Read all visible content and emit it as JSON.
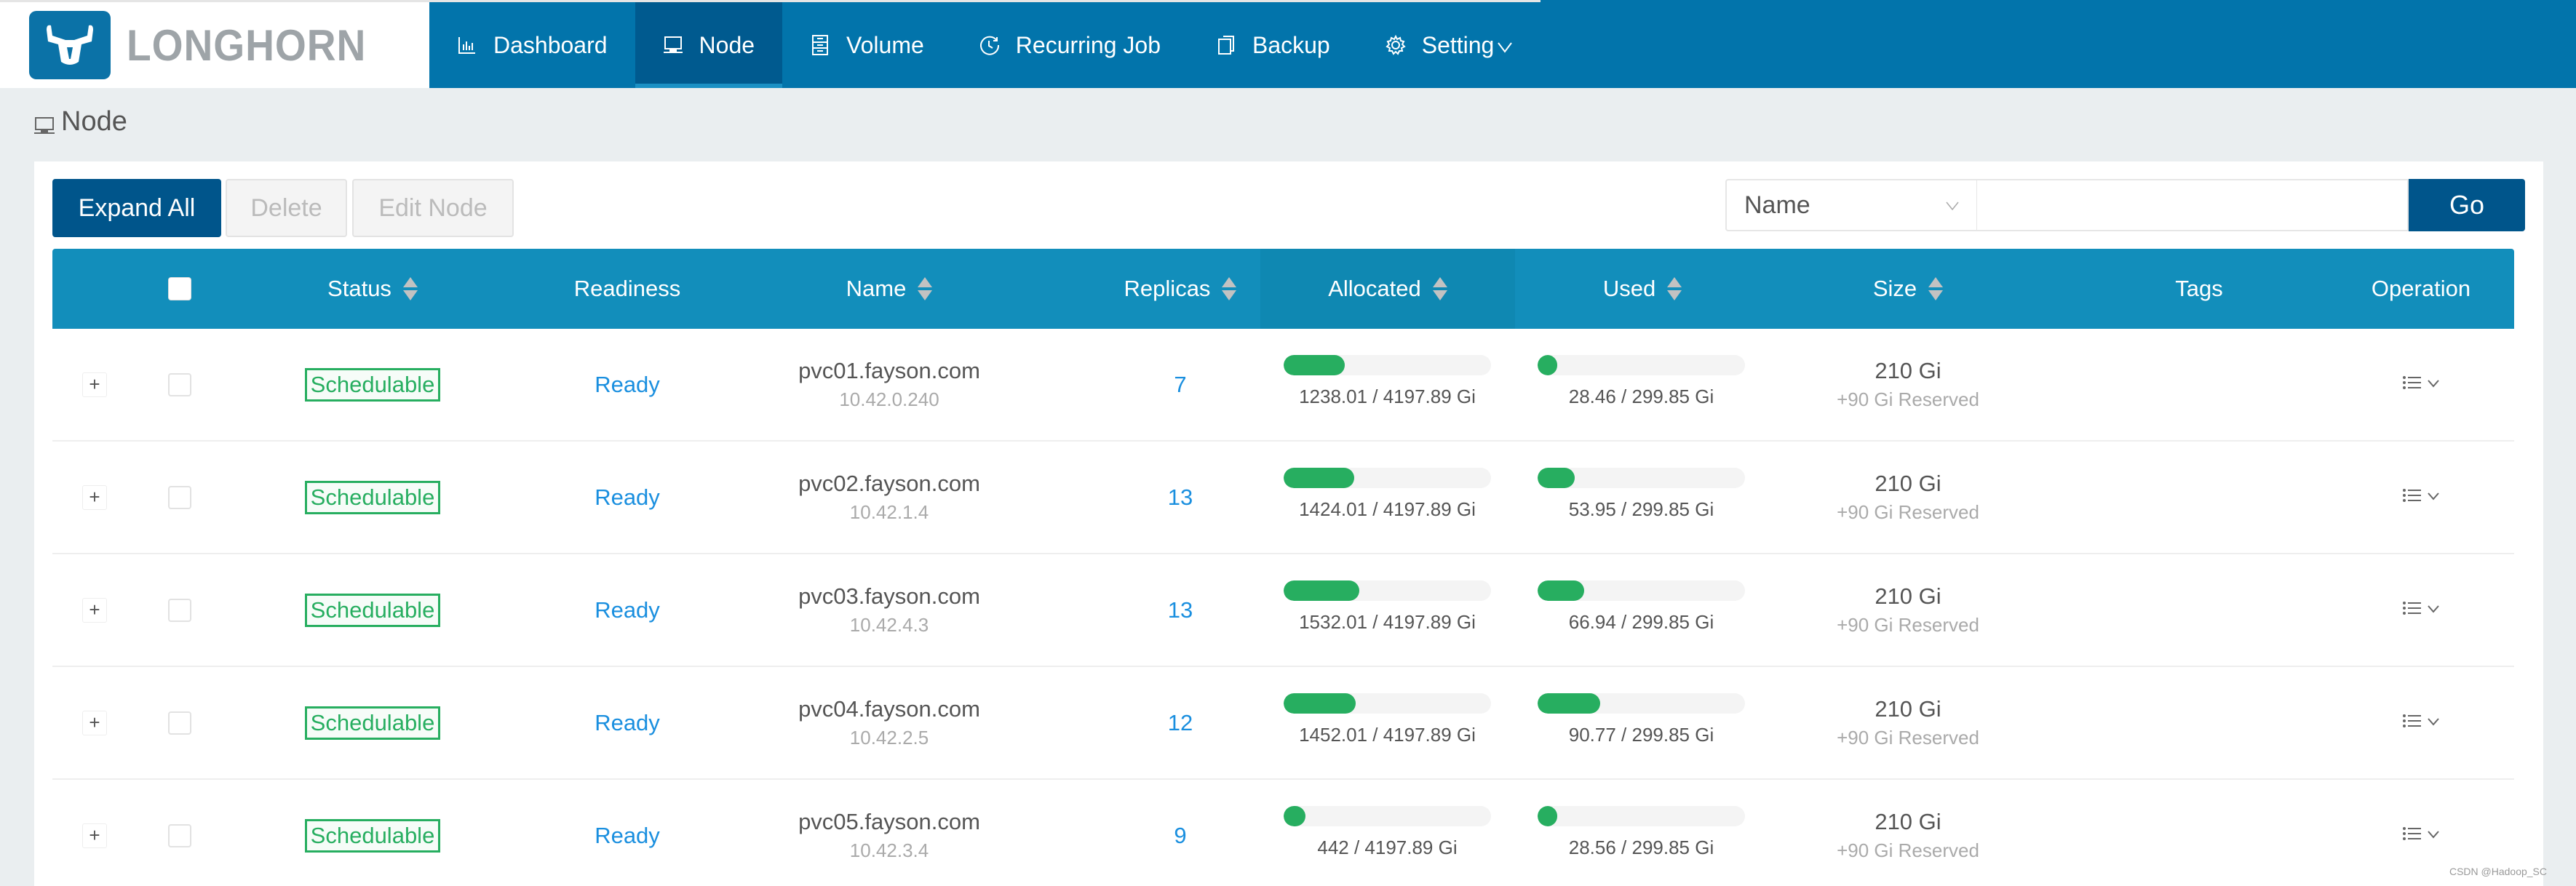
{
  "brand": {
    "name": "LONGHORN",
    "logo_icon": "longhorn-logo-icon"
  },
  "nav": [
    {
      "label": "Dashboard",
      "icon": "bar-chart-icon",
      "active": false
    },
    {
      "label": "Node",
      "icon": "laptop-icon",
      "active": true
    },
    {
      "label": "Volume",
      "icon": "database-icon",
      "active": false
    },
    {
      "label": "Recurring Job",
      "icon": "clock-icon",
      "active": false
    },
    {
      "label": "Backup",
      "icon": "copy-icon",
      "active": false
    },
    {
      "label": "Setting",
      "icon": "gear-icon",
      "active": false,
      "has_dropdown": true
    }
  ],
  "page": {
    "title": "Node",
    "icon": "laptop-icon"
  },
  "toolbar": {
    "expand_all": "Expand All",
    "delete": "Delete",
    "edit_node": "Edit Node"
  },
  "search": {
    "field_selected": "Name",
    "input_value": "",
    "input_placeholder": "",
    "go_label": "Go"
  },
  "table": {
    "headers": {
      "status": "Status",
      "readiness": "Readiness",
      "name": "Name",
      "replicas": "Replicas",
      "allocated": "Allocated",
      "used": "Used",
      "size": "Size",
      "tags": "Tags",
      "operation": "Operation"
    },
    "rows": [
      {
        "status": "Schedulable",
        "readiness": "Ready",
        "name": "pvc01.fayson.com",
        "ip": "10.42.0.240",
        "replicas": "7",
        "allocated_label": "1238.01 / 4197.89 Gi",
        "allocated_fraction": 0.295,
        "used_label": "28.46 / 299.85 Gi",
        "used_fraction": 0.095,
        "size": "210 Gi",
        "reserved": "+90 Gi Reserved",
        "tags": ""
      },
      {
        "status": "Schedulable",
        "readiness": "Ready",
        "name": "pvc02.fayson.com",
        "ip": "10.42.1.4",
        "replicas": "13",
        "allocated_label": "1424.01 / 4197.89 Gi",
        "allocated_fraction": 0.339,
        "used_label": "53.95 / 299.85 Gi",
        "used_fraction": 0.18,
        "size": "210 Gi",
        "reserved": "+90 Gi Reserved",
        "tags": ""
      },
      {
        "status": "Schedulable",
        "readiness": "Ready",
        "name": "pvc03.fayson.com",
        "ip": "10.42.4.3",
        "replicas": "13",
        "allocated_label": "1532.01 / 4197.89 Gi",
        "allocated_fraction": 0.365,
        "used_label": "66.94 / 299.85 Gi",
        "used_fraction": 0.223,
        "size": "210 Gi",
        "reserved": "+90 Gi Reserved",
        "tags": ""
      },
      {
        "status": "Schedulable",
        "readiness": "Ready",
        "name": "pvc04.fayson.com",
        "ip": "10.42.2.5",
        "replicas": "12",
        "allocated_label": "1452.01 / 4197.89 Gi",
        "allocated_fraction": 0.346,
        "used_label": "90.77 / 299.85 Gi",
        "used_fraction": 0.303,
        "size": "210 Gi",
        "reserved": "+90 Gi Reserved",
        "tags": ""
      },
      {
        "status": "Schedulable",
        "readiness": "Ready",
        "name": "pvc05.fayson.com",
        "ip": "10.42.3.4",
        "replicas": "9",
        "allocated_label": "442 / 4197.89 Gi",
        "allocated_fraction": 0.105,
        "used_label": "28.56 / 299.85 Gi",
        "used_fraction": 0.095,
        "size": "210 Gi",
        "reserved": "+90 Gi Reserved",
        "tags": ""
      }
    ]
  },
  "colors": {
    "header_bg": "#0274ab",
    "active_nav": "#005a8f",
    "table_header": "#128ebb",
    "primary_button": "#00558b",
    "success": "#27ae60",
    "link": "#1a8fdf"
  },
  "watermark": "CSDN @Hadoop_SC"
}
